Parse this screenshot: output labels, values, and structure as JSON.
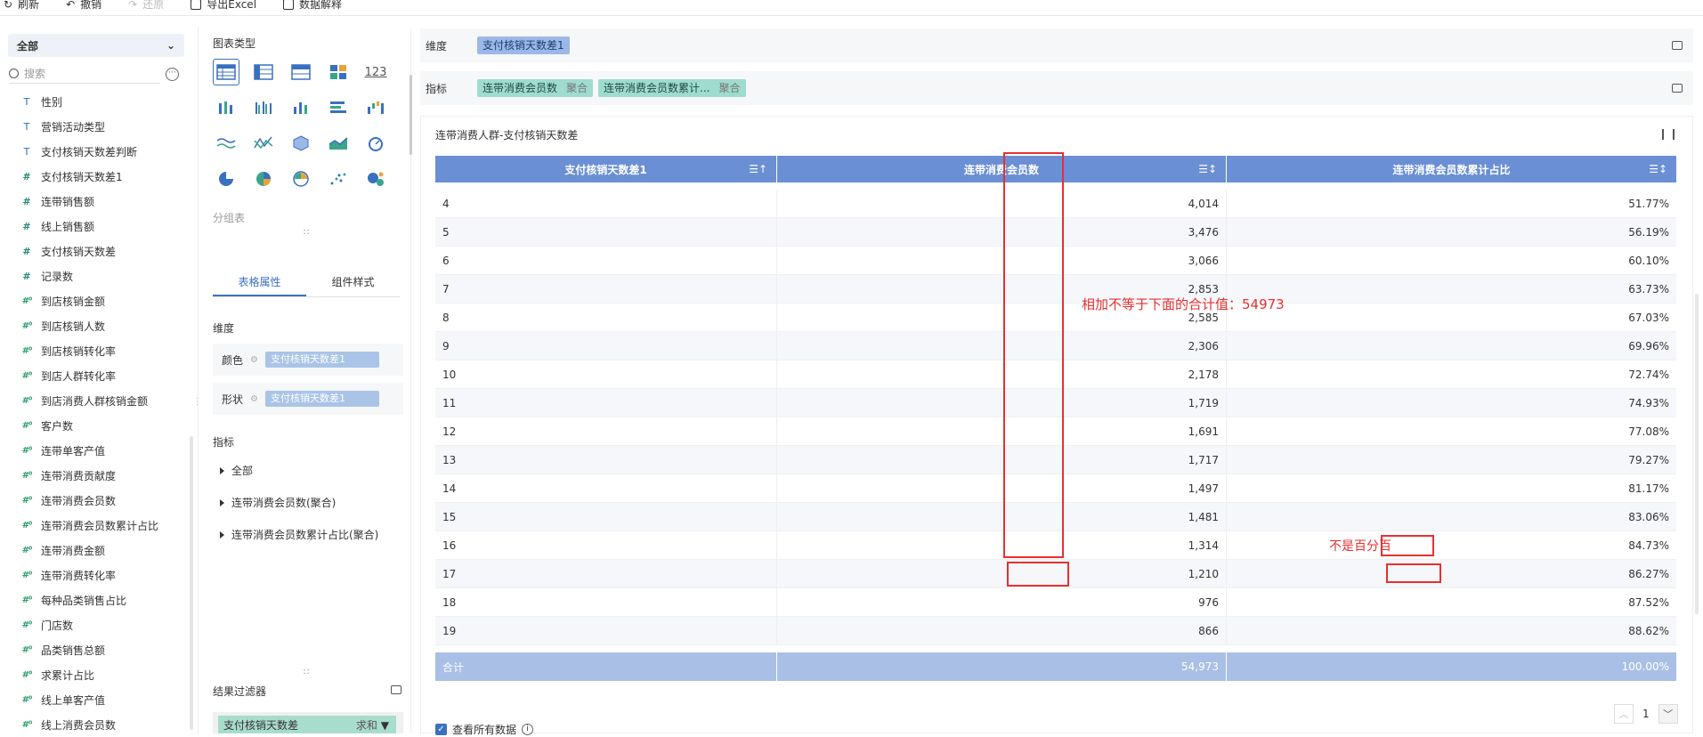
{
  "toolbar": {
    "refresh": "刷新",
    "undo": "撤销",
    "redo": "还原",
    "export": "导出Excel",
    "explain": "数据解释"
  },
  "left": {
    "dropdown": "全部",
    "search_placeholder": "搜索",
    "fields": [
      {
        "type": "T",
        "label": "性别"
      },
      {
        "type": "T",
        "label": "营销活动类型"
      },
      {
        "type": "T",
        "label": "支付核销天数差判断"
      },
      {
        "type": "#",
        "label": "支付核销天数差1"
      },
      {
        "type": "#",
        "label": "连带销售额"
      },
      {
        "type": "#",
        "label": "线上销售额"
      },
      {
        "type": "#",
        "label": "支付核销天数差"
      },
      {
        "type": "#",
        "label": "记录数"
      },
      {
        "type": "calc",
        "label": "到店核销金额"
      },
      {
        "type": "calc",
        "label": "到店核销人数"
      },
      {
        "type": "calc",
        "label": "到店核销转化率"
      },
      {
        "type": "calc",
        "label": "到店人群转化率"
      },
      {
        "type": "calc",
        "label": "到店消费人群核销金额"
      },
      {
        "type": "calc",
        "label": "客户数"
      },
      {
        "type": "calc",
        "label": "连带单客产值"
      },
      {
        "type": "calc",
        "label": "连带消费贡献度"
      },
      {
        "type": "calc",
        "label": "连带消费会员数"
      },
      {
        "type": "calc",
        "label": "连带消费会员数累计占比"
      },
      {
        "type": "calc",
        "label": "连带消费金额"
      },
      {
        "type": "calc",
        "label": "连带消费转化率"
      },
      {
        "type": "calc",
        "label": "每种品类销售占比"
      },
      {
        "type": "calc",
        "label": "门店数"
      },
      {
        "type": "calc",
        "label": "品类销售总额"
      },
      {
        "type": "calc",
        "label": "求累计占比"
      },
      {
        "type": "calc",
        "label": "线上单客产值"
      },
      {
        "type": "calc",
        "label": "线上消费会员数"
      }
    ]
  },
  "mid": {
    "chart_type_title": "图表类型",
    "table_123": "123",
    "group_table": "分组表",
    "tab_table_props": "表格属性",
    "tab_component_style": "组件样式",
    "dimension_title": "维度",
    "color_label": "颜色",
    "color_value": "支付核销天数差1",
    "shape_label": "形状",
    "shape_value": "支付核销天数差1",
    "measure_title": "指标",
    "tree": [
      "全部",
      "连带消费会员数(聚合)",
      "连带消费会员数累计占比(聚合)"
    ],
    "result_filter_title": "结果过滤器",
    "filter_field": "支付核销天数差",
    "filter_agg": "求和"
  },
  "slots": {
    "dimension_label": "维度",
    "dimension_pill": "支付核销天数差1",
    "measure_label": "指标",
    "measure_pills": [
      {
        "name": "连带消费会员数",
        "agg": "聚合"
      },
      {
        "name": "连带消费会员数累计...",
        "agg": "聚合"
      }
    ]
  },
  "chart": {
    "title": "连带消费人群-支付核销天数差",
    "headers": [
      "支付核销天数差1",
      "连带消费会员数",
      "连带消费会员数累计占比"
    ],
    "rows": [
      [
        "4",
        "4,014",
        "51.77%"
      ],
      [
        "5",
        "3,476",
        "56.19%"
      ],
      [
        "6",
        "3,066",
        "60.10%"
      ],
      [
        "7",
        "2,853",
        "63.73%"
      ],
      [
        "8",
        "2,585",
        "67.03%"
      ],
      [
        "9",
        "2,306",
        "69.96%"
      ],
      [
        "10",
        "2,178",
        "72.74%"
      ],
      [
        "11",
        "1,719",
        "74.93%"
      ],
      [
        "12",
        "1,691",
        "77.08%"
      ],
      [
        "13",
        "1,717",
        "79.27%"
      ],
      [
        "14",
        "1,497",
        "81.17%"
      ],
      [
        "15",
        "1,481",
        "83.06%"
      ],
      [
        "16",
        "1,314",
        "84.73%"
      ],
      [
        "17",
        "1,210",
        "86.27%"
      ],
      [
        "18",
        "976",
        "87.52%"
      ],
      [
        "19",
        "866",
        "88.62%"
      ]
    ],
    "total_label": "合计",
    "total_count": "54,973",
    "total_pct": "100.00%",
    "page": "1",
    "view_all": "查看所有数据"
  },
  "annotations": {
    "sum_note": "相加不等于下面的合计值：54973",
    "pct_note": "不是百分百"
  },
  "colors": {
    "header": "#6a8fd4",
    "footer": "#a9bfe6",
    "annotation": "#e63030",
    "accent": "#3a70c0"
  }
}
